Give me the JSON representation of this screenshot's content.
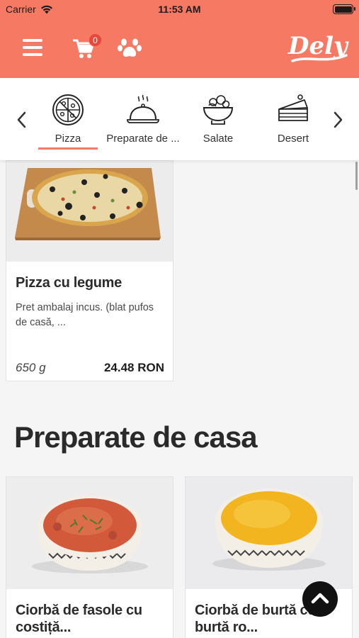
{
  "status_bar": {
    "carrier": "Carrier",
    "time": "11:53 AM"
  },
  "header": {
    "cart_count": "0",
    "brand": "Dely",
    "accent_color": "#f67a63"
  },
  "categories": [
    {
      "label": "Pizza",
      "icon": "pizza-icon",
      "selected": true
    },
    {
      "label": "Preparate de ...",
      "icon": "cloche-icon",
      "selected": false
    },
    {
      "label": "Salate",
      "icon": "salad-bowl-icon",
      "selected": false
    },
    {
      "label": "Desert",
      "icon": "cake-slice-icon",
      "selected": false
    }
  ],
  "products": [
    {
      "title": "Pizza cu legume",
      "description": "Pret ambalaj incus. (blat pufos de casă, ...",
      "weight": "650 g",
      "price": "24.48 RON"
    }
  ],
  "section": {
    "title": "Preparate de casa"
  },
  "section_products": [
    {
      "title": "Ciorbă de fasole cu costiță..."
    },
    {
      "title": "Ciorbă de burtă cu burtă ro..."
    }
  ]
}
